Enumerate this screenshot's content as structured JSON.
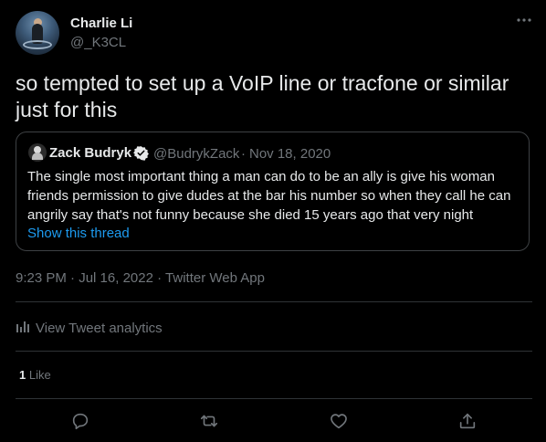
{
  "author": {
    "name": "Charlie Li",
    "handle": "@_K3CL"
  },
  "tweet": {
    "text": "so tempted to set up a VoIP line or tracfone or similar just for this"
  },
  "quoted_tweet": {
    "name": "Zack Budryk",
    "handle": "@BudrykZack",
    "separator": "·",
    "date": "Nov 18, 2020",
    "text": "The single most important thing a man can do to be an ally is give his woman friends permission to give dudes at the bar his number so when they call he can angrily say that's not funny because she died 15 years ago that very night",
    "show_thread": "Show this thread"
  },
  "meta": {
    "time": "9:23 PM",
    "sep1": "·",
    "date": "Jul 16, 2022",
    "sep2": "·",
    "source": "Twitter Web App"
  },
  "analytics": {
    "label": "View Tweet analytics"
  },
  "stats": {
    "likes_count": "1",
    "likes_label": "Like"
  },
  "actions": {
    "icons": [
      "reply-icon",
      "retweet-icon",
      "like-icon",
      "share-icon"
    ]
  },
  "colors": {
    "background": "#000000",
    "text": "#e7e9ea",
    "secondary": "#71767b",
    "link": "#1d9bf0",
    "border": "#2f3336"
  }
}
